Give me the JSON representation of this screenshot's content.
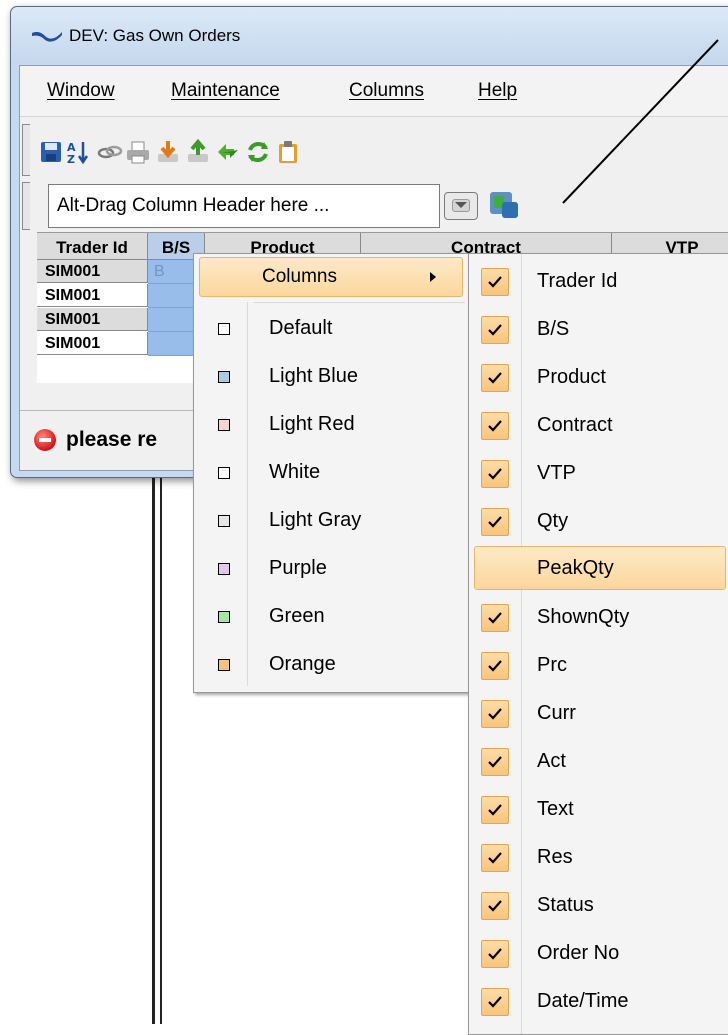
{
  "window": {
    "title": "DEV: Gas Own Orders"
  },
  "menu": [
    {
      "label": "Window"
    },
    {
      "label": "Maintenance"
    },
    {
      "label": "Columns"
    },
    {
      "label": "Help"
    }
  ],
  "toolbar": {
    "icons": [
      "save-icon",
      "sort-icon",
      "link-icon",
      "print-icon",
      "download-icon",
      "upload-icon",
      "sync-icon",
      "refresh-icon",
      "clipboard-icon"
    ]
  },
  "groupbox": {
    "text": "Alt-Drag Column Header here ..."
  },
  "grid": {
    "headers": [
      "Trader Id",
      "B/S",
      "Product",
      "Contract",
      "VTP"
    ],
    "rows": [
      {
        "trader": "SIM001",
        "bs": "B"
      },
      {
        "trader": "SIM001",
        "bs": ""
      },
      {
        "trader": "SIM001",
        "bs": ""
      },
      {
        "trader": "SIM001",
        "bs": ""
      }
    ]
  },
  "status": {
    "text": "please re"
  },
  "context_menu": {
    "columns_label": "Columns",
    "colors": [
      {
        "label": "Default",
        "color": "#ffffff"
      },
      {
        "label": "Light Blue",
        "color": "#a9cce6"
      },
      {
        "label": "Light Red",
        "color": "#f6d3d3"
      },
      {
        "label": "White",
        "color": "#ffffff"
      },
      {
        "label": "Light Gray",
        "color": "#e6e6e6"
      },
      {
        "label": "Purple",
        "color": "#e3c8ee"
      },
      {
        "label": "Green",
        "color": "#a5e6a5"
      },
      {
        "label": "Orange",
        "color": "#f7c27a"
      }
    ]
  },
  "columns_submenu": [
    {
      "label": "Trader Id",
      "checked": true
    },
    {
      "label": "B/S",
      "checked": true
    },
    {
      "label": "Product",
      "checked": true
    },
    {
      "label": "Contract",
      "checked": true
    },
    {
      "label": "VTP",
      "checked": true
    },
    {
      "label": "Qty",
      "checked": true
    },
    {
      "label": "PeakQty",
      "checked": false,
      "highlighted": true
    },
    {
      "label": "ShownQty",
      "checked": true
    },
    {
      "label": "Prc",
      "checked": true
    },
    {
      "label": "Curr",
      "checked": true
    },
    {
      "label": "Act",
      "checked": true
    },
    {
      "label": "Text",
      "checked": true
    },
    {
      "label": "Res",
      "checked": true
    },
    {
      "label": "Status",
      "checked": true
    },
    {
      "label": "Order No",
      "checked": true
    },
    {
      "label": "Date/Time",
      "checked": true
    }
  ]
}
